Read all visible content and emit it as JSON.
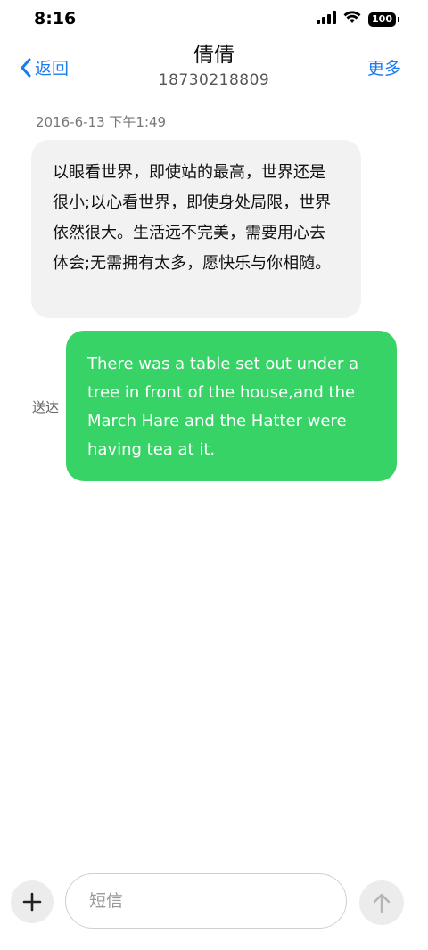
{
  "status_bar": {
    "time": "8:16",
    "battery": "100",
    "icons": [
      "signal-icon",
      "wifi-icon",
      "battery-icon"
    ]
  },
  "header": {
    "back_label": "返回",
    "contact_name": "倩倩",
    "contact_number": "18730218809",
    "more_label": "更多"
  },
  "conversation": {
    "timestamp": "2016-6-13 下午1:49",
    "messages": [
      {
        "direction": "incoming",
        "text": "以眼看世界，即使站的最高，世界还是很小;以心看世界，即使身处局限，世界依然很大。生活远不完美，需要用心去体会;无需拥有太多，愿快乐与你相随。"
      },
      {
        "direction": "outgoing",
        "text": "There was a table set out under a tree in front of the house,and the March Hare and the Hatter were having tea at it.",
        "status": "送达"
      }
    ]
  },
  "composer": {
    "placeholder": "短信",
    "value": ""
  },
  "colors": {
    "accent": "#1a7cf0",
    "outgoing_bubble": "#37d366",
    "incoming_bubble": "#f2f2f3"
  }
}
